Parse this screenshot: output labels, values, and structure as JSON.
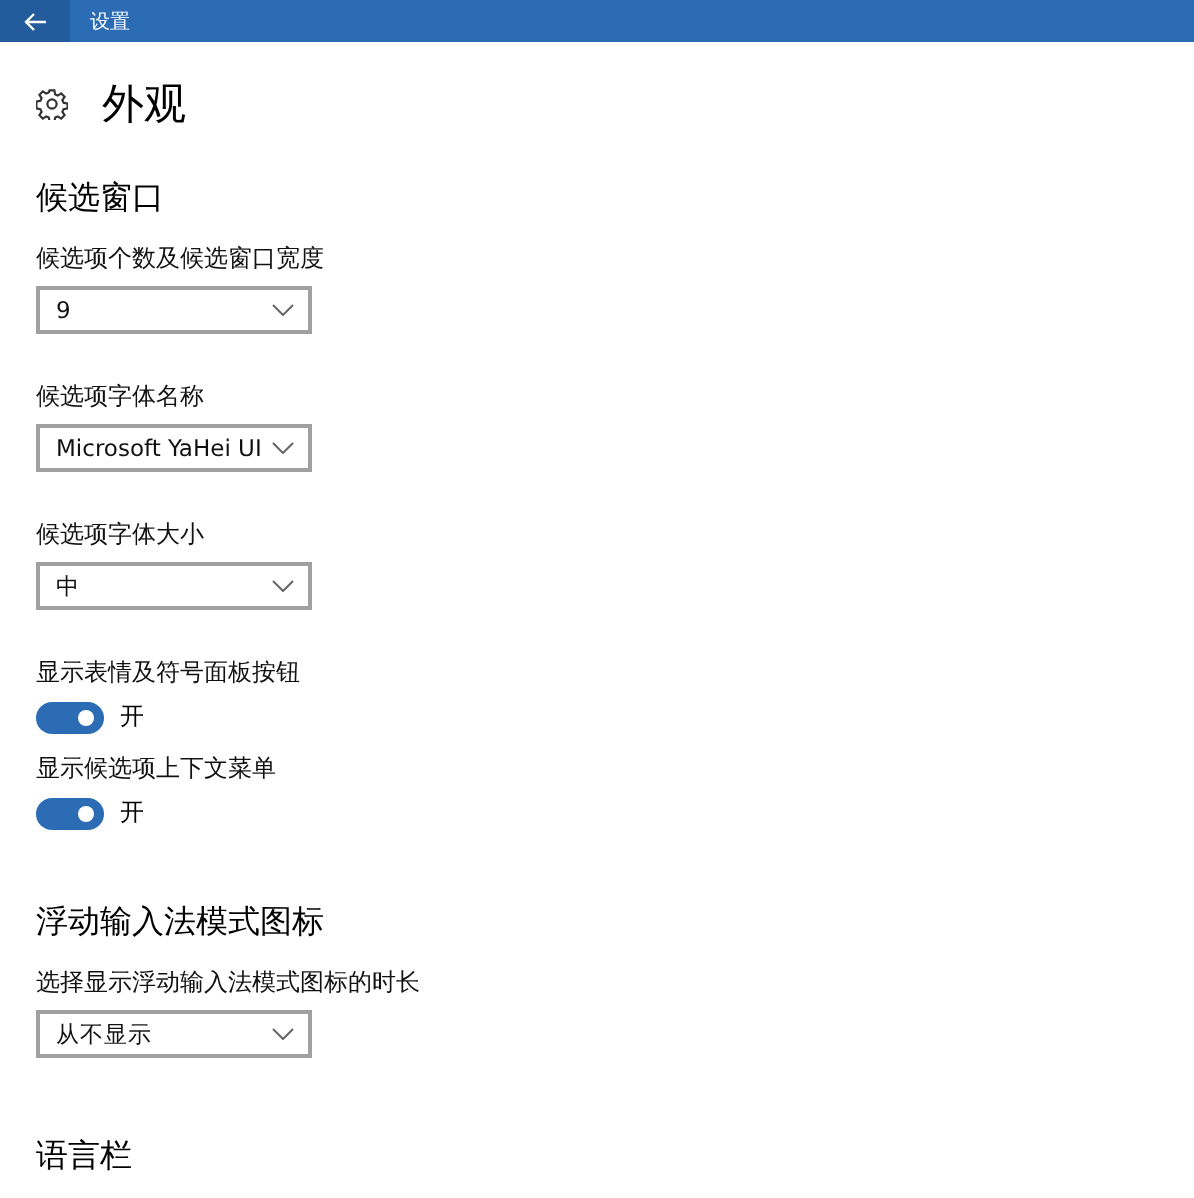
{
  "title_bar": {
    "title": "设置"
  },
  "page": {
    "title": "外观"
  },
  "items": [
    {
      "kind": "heading",
      "text": "候选窗口"
    },
    {
      "kind": "dropdown",
      "label": "候选项个数及候选窗口宽度",
      "value": "9"
    },
    {
      "kind": "dropdown",
      "label": "候选项字体名称",
      "value": "Microsoft YaHei UI"
    },
    {
      "kind": "dropdown",
      "label": "候选项字体大小",
      "value": "中"
    },
    {
      "kind": "toggle",
      "label": "显示表情及符号面板按钮",
      "on": true,
      "state_text": "开"
    },
    {
      "kind": "toggle",
      "label": "显示候选项上下文菜单",
      "on": true,
      "state_text": "开"
    },
    {
      "kind": "heading",
      "text": "浮动输入法模式图标"
    },
    {
      "kind": "dropdown",
      "label": "选择显示浮动输入法模式图标的时长",
      "value": "从不显示"
    },
    {
      "kind": "heading",
      "text": "语言栏"
    }
  ]
}
